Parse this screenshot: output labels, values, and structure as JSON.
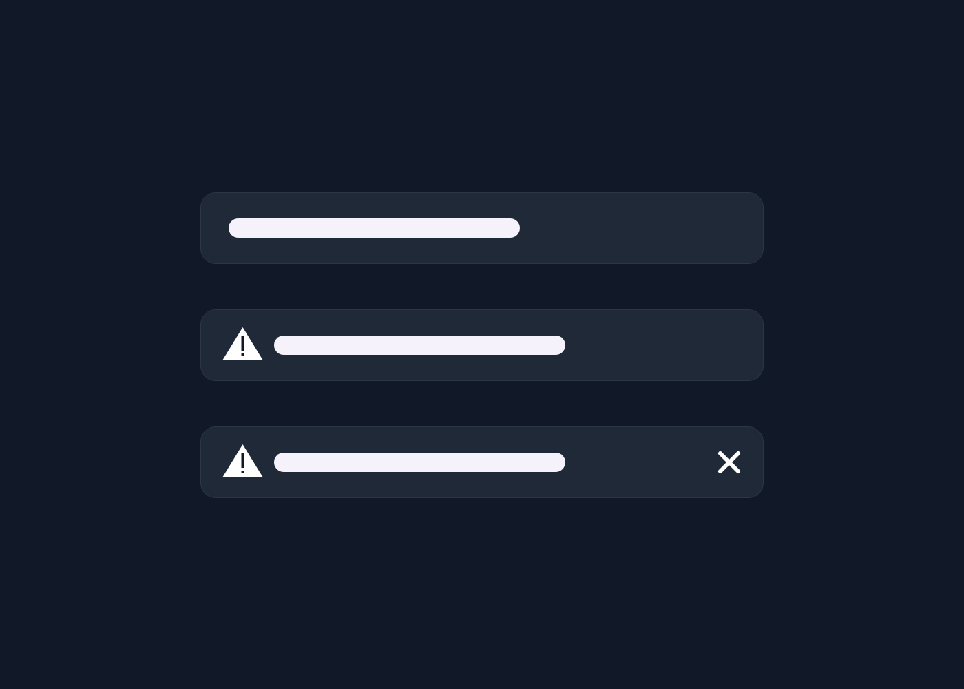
{
  "alerts": [
    {
      "warning": false,
      "dismissible": false
    },
    {
      "warning": true,
      "dismissible": false
    },
    {
      "warning": true,
      "dismissible": true
    }
  ]
}
